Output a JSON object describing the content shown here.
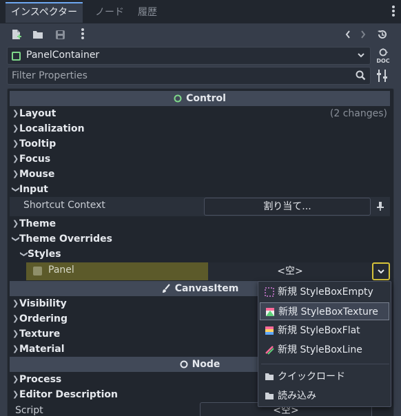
{
  "tabs": [
    "インスペクター",
    "ノード",
    "履歴"
  ],
  "object_selector": {
    "label": "PanelContainer"
  },
  "filter": {
    "placeholder": "Filter Properties",
    "value": ""
  },
  "sections": {
    "control": "Control",
    "canvas_item": "CanvasItem",
    "node": "Node"
  },
  "control_rows": {
    "layout": "Layout",
    "layout_note": "(2 changes)",
    "localization": "Localization",
    "tooltip": "Tooltip",
    "focus": "Focus",
    "mouse": "Mouse",
    "input": "Input",
    "theme": "Theme",
    "theme_overrides": "Theme Overrides",
    "styles": "Styles"
  },
  "shortcut": {
    "label": "Shortcut Context",
    "button": "割り当て..."
  },
  "panel_prop": {
    "label": "Panel",
    "value": "<空>"
  },
  "canvas_rows": {
    "visibility": "Visibility",
    "ordering": "Ordering",
    "texture": "Texture",
    "material": "Material"
  },
  "node_rows": {
    "process": "Process",
    "editor_description": "Editor Description"
  },
  "script": {
    "label": "Script",
    "value": "<空>"
  },
  "popup": {
    "new_empty": "新規 StyleBoxEmpty",
    "new_texture": "新規 StyleBoxTexture",
    "new_flat": "新規 StyleBoxFlat",
    "new_line": "新規 StyleBoxLine",
    "quick_load": "クイックロード",
    "load": "読み込み"
  },
  "colors": {
    "accent": "#6ea8f2",
    "control_green": "#7fd88a",
    "override_yellow": "#d8c43a",
    "bg": "#363d4a"
  }
}
